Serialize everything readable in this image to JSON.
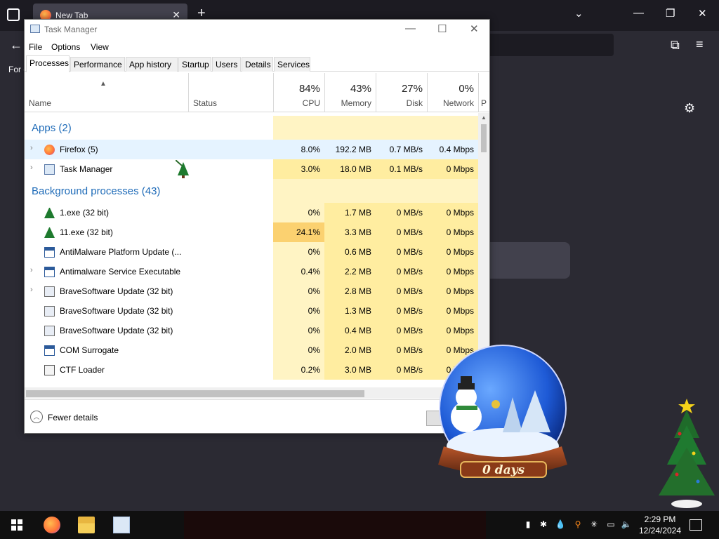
{
  "browser": {
    "tab_label": "New Tab",
    "close_glyph": "✕",
    "new_tab_glyph": "+",
    "bookmark_text": "For c"
  },
  "taskmgr": {
    "title": "Task Manager",
    "window_controls": {
      "minimize": "—",
      "maximize": "☐",
      "close": "✕"
    },
    "menu": [
      "File",
      "Options",
      "View"
    ],
    "tabs": [
      "Processes",
      "Performance",
      "App history",
      "Startup",
      "Users",
      "Details",
      "Services"
    ],
    "active_tab": "Processes",
    "columns": {
      "name": "Name",
      "status": "Status",
      "cpu": {
        "pct": "84%",
        "label": "CPU"
      },
      "memory": {
        "pct": "43%",
        "label": "Memory"
      },
      "disk": {
        "pct": "27%",
        "label": "Disk"
      },
      "network": {
        "pct": "0%",
        "label": "Network"
      },
      "partial": "P"
    },
    "groups": [
      {
        "label": "Apps (2)"
      },
      {
        "label": "Background processes (43)"
      }
    ],
    "apps": [
      {
        "name": "Firefox (5)",
        "icon": "firefox-icon",
        "expandable": true,
        "cpu": "8.0%",
        "memory": "192.2 MB",
        "disk": "0.7 MB/s",
        "network": "0.4 Mbps",
        "selected": true
      },
      {
        "name": "Task Manager",
        "icon": "task-manager-icon",
        "expandable": true,
        "cpu": "3.0%",
        "memory": "18.0 MB",
        "disk": "0.1 MB/s",
        "network": "0 Mbps"
      }
    ],
    "background": [
      {
        "name": "1.exe (32 bit)",
        "icon": "tree-icon",
        "expandable": false,
        "cpu": "0%",
        "memory": "1.7 MB",
        "disk": "0 MB/s",
        "network": "0 Mbps"
      },
      {
        "name": "11.exe (32 bit)",
        "icon": "tree-icon",
        "expandable": false,
        "cpu": "24.1%",
        "memory": "3.3 MB",
        "disk": "0 MB/s",
        "network": "0 Mbps"
      },
      {
        "name": "AntiMalware Platform Update (...",
        "icon": "window-icon",
        "expandable": false,
        "cpu": "0%",
        "memory": "0.6 MB",
        "disk": "0 MB/s",
        "network": "0 Mbps"
      },
      {
        "name": "Antimalware Service Executable",
        "icon": "window-icon",
        "expandable": true,
        "cpu": "0.4%",
        "memory": "2.2 MB",
        "disk": "0 MB/s",
        "network": "0 Mbps"
      },
      {
        "name": "BraveSoftware Update (32 bit)",
        "icon": "brave-update-icon",
        "expandable": true,
        "cpu": "0%",
        "memory": "2.8 MB",
        "disk": "0 MB/s",
        "network": "0 Mbps"
      },
      {
        "name": "BraveSoftware Update (32 bit)",
        "icon": "brave-update-icon",
        "expandable": false,
        "cpu": "0%",
        "memory": "1.3 MB",
        "disk": "0 MB/s",
        "network": "0 Mbps"
      },
      {
        "name": "BraveSoftware Update (32 bit)",
        "icon": "brave-update-icon",
        "expandable": false,
        "cpu": "0%",
        "memory": "0.4 MB",
        "disk": "0 MB/s",
        "network": "0 Mbps"
      },
      {
        "name": "COM Surrogate",
        "icon": "window-icon",
        "expandable": false,
        "cpu": "0%",
        "memory": "2.0 MB",
        "disk": "0 MB/s",
        "network": "0 Mbps"
      },
      {
        "name": "CTF Loader",
        "icon": "ctf-loader-icon",
        "expandable": false,
        "cpu": "0.2%",
        "memory": "3.0 MB",
        "disk": "0 MB/s",
        "network": "0 Mbps"
      }
    ],
    "footer": {
      "fewer_details": "Fewer details"
    }
  },
  "desktop": {
    "snow_globe_text": "0 days"
  },
  "taskbar": {
    "time": "2:29 PM",
    "date": "12/24/2024"
  },
  "colors": {
    "group_header": "#1e6bb8",
    "heat_low": "#fff4c4",
    "heat_mid": "#ffeda0",
    "heat_high": "#fbd170",
    "selected_row": "#e5f3ff"
  }
}
